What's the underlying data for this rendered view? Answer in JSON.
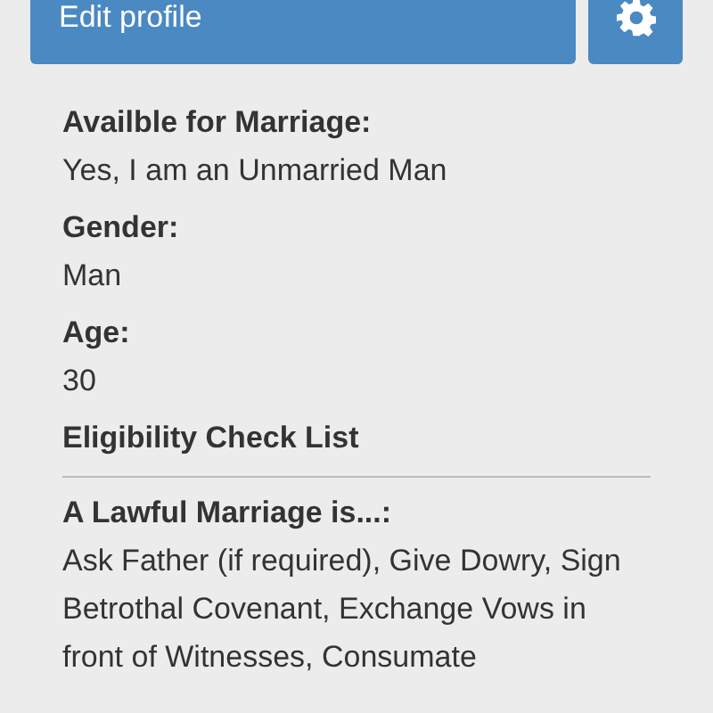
{
  "toolbar": {
    "edit_button": "Edit profile"
  },
  "fields": [
    {
      "label": "Availble for Marriage:",
      "value": "Yes, I am an Unmarried Man"
    },
    {
      "label": "Gender:",
      "value": "Man"
    },
    {
      "label": "Age:",
      "value": "30"
    }
  ],
  "section": {
    "title": "Eligibility Check List",
    "fields": [
      {
        "label": "A Lawful Marriage is...:",
        "value": "Ask Father (if required), Give Dowry, Sign Betrothal Covenant, Exchange Vows in front of Witnesses, Consumate"
      }
    ]
  }
}
